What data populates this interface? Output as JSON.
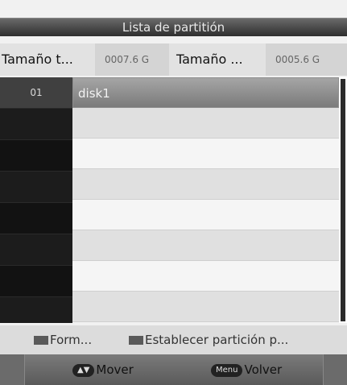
{
  "window": {
    "title": "Lista de partitión"
  },
  "info_row": {
    "label1": "Tamaño t...",
    "value1": "0007.6 G",
    "label2": "Tamaño ...",
    "value2": "0005.6 G"
  },
  "list": {
    "items": [
      {
        "number": "01",
        "name": "disk1",
        "selected": true
      },
      {
        "number": "",
        "name": "",
        "selected": false
      },
      {
        "number": "",
        "name": "",
        "selected": false
      },
      {
        "number": "",
        "name": "",
        "selected": false
      },
      {
        "number": "",
        "name": "",
        "selected": false
      },
      {
        "number": "",
        "name": "",
        "selected": false
      },
      {
        "number": "",
        "name": "",
        "selected": false
      },
      {
        "number": "",
        "name": "",
        "selected": false
      }
    ]
  },
  "hints": {
    "format_label": "Form...",
    "set_partition_label": "Establecer partición p..."
  },
  "footer": {
    "move_key": "▲▼",
    "move_label": "Mover",
    "menu_key": "Menu",
    "back_label": "Volver"
  }
}
